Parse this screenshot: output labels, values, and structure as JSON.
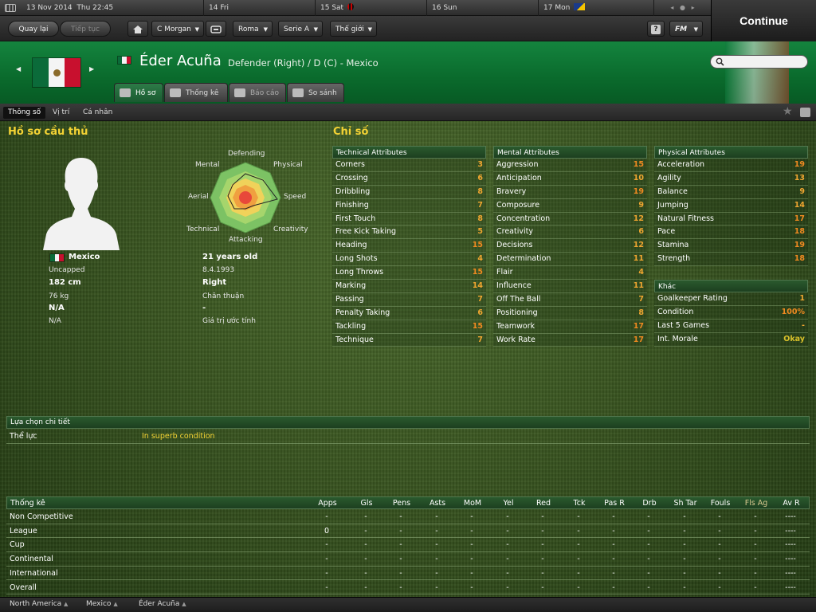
{
  "datebar": {
    "current_date": "13 Nov 2014",
    "current_time": "Thu 22:45",
    "days": [
      "14 Fri",
      "15 Sat",
      "16 Sun",
      "17 Mon"
    ]
  },
  "nav": {
    "back": "Quay lại",
    "forward": "Tiếp tục",
    "manager": "C Morgan",
    "club": "Roma",
    "league": "Serie A",
    "world": "Thế giới",
    "help": "?",
    "fm": "FM",
    "continue": "Continue"
  },
  "player": {
    "name": "Éder Acuña",
    "position": "Defender (Right) / D (C) - Mexico"
  },
  "tabs": [
    "Hồ sơ",
    "Thống kê",
    "Báo cáo",
    "So sánh"
  ],
  "subtabs": [
    "Thông số",
    "Vị trí",
    "Cá nhân"
  ],
  "profile": {
    "title": "Hồ sơ cầu thủ",
    "nationality": "Mexico",
    "caps": "Uncapped",
    "height": "182 cm",
    "weight": "76 kg",
    "value": "N/A",
    "value2": "N/A",
    "age": "21 years old",
    "dob": "8.4.1993",
    "foot": "Right",
    "foot_label": "Chân thuận",
    "dash": "-",
    "value_label": "Giá trị ước tính",
    "radar": {
      "defending": "Defending",
      "physical": "Physical",
      "speed": "Speed",
      "creativity": "Creativity",
      "attacking": "Attacking",
      "technical": "Technical",
      "aerial": "Aerial",
      "mental": "Mental"
    }
  },
  "attributes": {
    "title": "Chỉ số",
    "technical_header": "Technical Attributes",
    "technical": [
      {
        "name": "Corners",
        "value": "3"
      },
      {
        "name": "Crossing",
        "value": "6"
      },
      {
        "name": "Dribbling",
        "value": "8"
      },
      {
        "name": "Finishing",
        "value": "7"
      },
      {
        "name": "First Touch",
        "value": "8"
      },
      {
        "name": "Free Kick Taking",
        "value": "5"
      },
      {
        "name": "Heading",
        "value": "15"
      },
      {
        "name": "Long Shots",
        "value": "4"
      },
      {
        "name": "Long Throws",
        "value": "15"
      },
      {
        "name": "Marking",
        "value": "14"
      },
      {
        "name": "Passing",
        "value": "7"
      },
      {
        "name": "Penalty Taking",
        "value": "6"
      },
      {
        "name": "Tackling",
        "value": "15"
      },
      {
        "name": "Technique",
        "value": "7"
      }
    ],
    "mental_header": "Mental Attributes",
    "mental": [
      {
        "name": "Aggression",
        "value": "15"
      },
      {
        "name": "Anticipation",
        "value": "10"
      },
      {
        "name": "Bravery",
        "value": "19"
      },
      {
        "name": "Composure",
        "value": "9"
      },
      {
        "name": "Concentration",
        "value": "12"
      },
      {
        "name": "Creativity",
        "value": "6"
      },
      {
        "name": "Decisions",
        "value": "12"
      },
      {
        "name": "Determination",
        "value": "11"
      },
      {
        "name": "Flair",
        "value": "4"
      },
      {
        "name": "Influence",
        "value": "11"
      },
      {
        "name": "Off The Ball",
        "value": "7"
      },
      {
        "name": "Positioning",
        "value": "8"
      },
      {
        "name": "Teamwork",
        "value": "17"
      },
      {
        "name": "Work Rate",
        "value": "17"
      }
    ],
    "physical_header": "Physical Attributes",
    "physical": [
      {
        "name": "Acceleration",
        "value": "19"
      },
      {
        "name": "Agility",
        "value": "13"
      },
      {
        "name": "Balance",
        "value": "9"
      },
      {
        "name": "Jumping",
        "value": "14"
      },
      {
        "name": "Natural Fitness",
        "value": "17"
      },
      {
        "name": "Pace",
        "value": "18"
      },
      {
        "name": "Stamina",
        "value": "19"
      },
      {
        "name": "Strength",
        "value": "18"
      }
    ],
    "other_header": "Khác",
    "other": [
      {
        "name": "Goalkeeper Rating",
        "value": "1"
      },
      {
        "name": "Condition",
        "value": "100%"
      },
      {
        "name": "Last 5 Games",
        "value": "-"
      },
      {
        "name": "Int. Morale",
        "value": "Okay"
      }
    ]
  },
  "details": {
    "header": "Lựa chọn chi tiết",
    "label": "Thể lực",
    "value": "In superb condition"
  },
  "stats": {
    "columns": [
      "Thống kê",
      "Apps",
      "Gls",
      "Pens",
      "Asts",
      "MoM",
      "Yel",
      "Red",
      "Tck",
      "Pas R",
      "Drb",
      "Sh Tar",
      "Fouls",
      "Fls Ag",
      "Av R"
    ],
    "rows": [
      [
        "Non Competitive",
        "-",
        "-",
        "-",
        "-",
        "-",
        "-",
        "-",
        "-",
        "-",
        "-",
        "-",
        "-",
        "-",
        "----"
      ],
      [
        "League",
        "0",
        "-",
        "-",
        "-",
        "-",
        "-",
        "-",
        "-",
        "-",
        "-",
        "-",
        "-",
        "-",
        "----"
      ],
      [
        "Cup",
        "-",
        "-",
        "-",
        "-",
        "-",
        "-",
        "-",
        "-",
        "-",
        "-",
        "-",
        "-",
        "-",
        "----"
      ],
      [
        "Continental",
        "-",
        "-",
        "-",
        "-",
        "-",
        "-",
        "-",
        "-",
        "-",
        "-",
        "-",
        "-",
        "-",
        "----"
      ],
      [
        "International",
        "-",
        "-",
        "-",
        "-",
        "-",
        "-",
        "-",
        "-",
        "-",
        "-",
        "-",
        "-",
        "-",
        "----"
      ],
      [
        "Overall",
        "-",
        "-",
        "-",
        "-",
        "-",
        "-",
        "-",
        "-",
        "-",
        "-",
        "-",
        "-",
        "-",
        "----"
      ]
    ]
  },
  "footer": [
    "North America",
    "Mexico",
    "Éder Acuña"
  ]
}
